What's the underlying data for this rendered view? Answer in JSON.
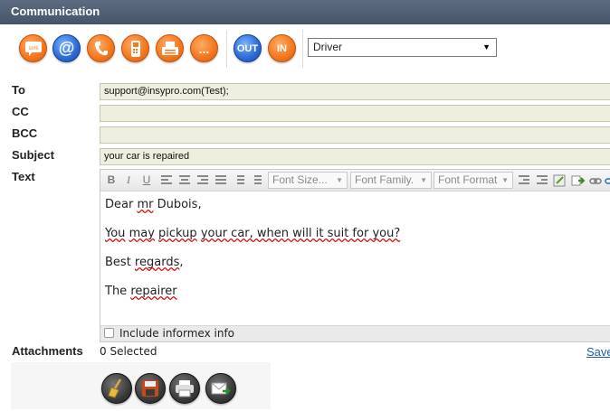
{
  "window": {
    "title": "Communication"
  },
  "toolbar": {
    "buttons": [
      {
        "name": "sms",
        "label": "sms"
      },
      {
        "name": "email",
        "label": "@"
      },
      {
        "name": "phone",
        "label": ""
      },
      {
        "name": "mobile",
        "label": ""
      },
      {
        "name": "fax",
        "label": ""
      },
      {
        "name": "more",
        "label": "..."
      }
    ],
    "out_label": "OUT",
    "in_label": "IN",
    "role_select": {
      "value": "Driver"
    }
  },
  "form": {
    "to_label": "To",
    "cc_label": "CC",
    "bcc_label": "BCC",
    "subject_label": "Subject",
    "text_label": "Text",
    "to_value": "support@insypro.com(Test);",
    "cc_value": "",
    "bcc_value": "",
    "subject_value": "your car is repaired"
  },
  "editor": {
    "font_size_placeholder": "Font Size...",
    "font_family_placeholder": "Font Family.",
    "font_format_placeholder": "Font Format",
    "body": {
      "l1_a": "Dear ",
      "l1_b": "mr",
      "l1_c": " Dubois,",
      "l2_a": "You",
      "l2_b": " ",
      "l2_c": "may",
      "l2_d": " ",
      "l2_e": "pickup",
      "l2_f": " ",
      "l2_g": "your car, when will it suit for you?",
      "l3_a": "Best ",
      "l3_b": "regards",
      "l3_c": ",",
      "l4_a": "The ",
      "l4_b": "repairer"
    },
    "include_label": "Include informex info"
  },
  "attachments": {
    "label": "Attachments",
    "status": "0 Selected",
    "save_link": "Save"
  },
  "colors": {
    "title_bar": "#4f5e72",
    "orange_button": "#f47a21",
    "blue_button": "#2e6fd9",
    "field_bg": "#efefdf"
  }
}
